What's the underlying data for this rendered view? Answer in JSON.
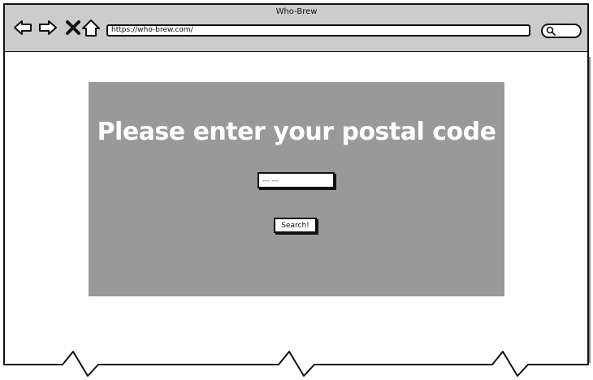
{
  "window": {
    "title": "Who-Brew"
  },
  "toolbar": {
    "back_icon": "arrow-left-icon",
    "forward_icon": "arrow-right-icon",
    "close_icon": "x-icon",
    "home_icon": "home-icon",
    "search_icon": "search-icon"
  },
  "address_bar": {
    "url": "https://who-brew.com/"
  },
  "main": {
    "heading": "Please enter your postal code",
    "postal_input": {
      "placeholder": "--- ---",
      "value": ""
    },
    "search_button_label": "Search!"
  },
  "colors": {
    "panel_background": "#999999",
    "chrome_background": "#cccccc",
    "heading_text": "#ffffff",
    "outline": "#111111"
  }
}
